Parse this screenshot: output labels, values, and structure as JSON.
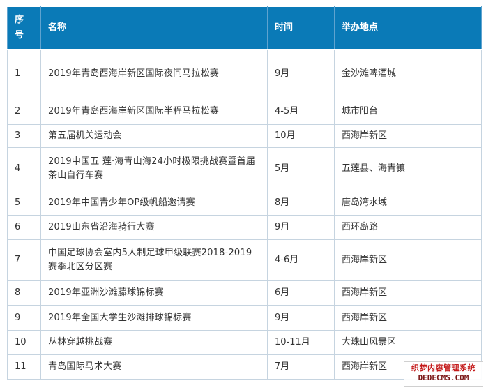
{
  "header": {
    "index_label": "序号",
    "name_label": "名称",
    "time_label": "时间",
    "venue_label": "举办地点"
  },
  "rows": [
    {
      "index": "1",
      "name": "2019年青岛西海岸新区国际夜间马拉松赛",
      "time": "9月",
      "venue": "金沙滩啤酒城"
    },
    {
      "index": "2",
      "name": "2019年青岛西海岸新区国际半程马拉松赛",
      "time": "4-5月",
      "venue": "城市阳台"
    },
    {
      "index": "3",
      "name": "第五届机关运动会",
      "time": "10月",
      "venue": "西海岸新区"
    },
    {
      "index": "4",
      "name": "2019中国五 莲·海青山海24小时极限挑战赛暨首届茶山自行车赛",
      "time": "5月",
      "venue": "五莲县、海青镇"
    },
    {
      "index": "5",
      "name": "2019年中国青少年OP级帆船邀请赛",
      "time": "8月",
      "venue": "唐岛湾水域"
    },
    {
      "index": "6",
      "name": "2019山东省沿海骑行大赛",
      "time": "9月",
      "venue": "西环岛路"
    },
    {
      "index": "7",
      "name": "中国足球协会室内5人制足球甲级联赛2018-2019 赛季北区分区赛",
      "time": "4-6月",
      "venue": "西海岸新区"
    },
    {
      "index": "8",
      "name": "2019年亚洲沙滩藤球锦标赛",
      "time": "6月",
      "venue": "西海岸新区"
    },
    {
      "index": "9",
      "name": "2019年全国大学生沙滩排球锦标赛",
      "time": "9月",
      "venue": "西海岸新区"
    },
    {
      "index": "10",
      "name": "丛林穿越挑战赛",
      "time": "10-11月",
      "venue": "大珠山风景区"
    },
    {
      "index": "11",
      "name": "青岛国际马术大赛",
      "time": "7月",
      "venue": "西海岸新区"
    }
  ],
  "watermark": {
    "line1": "织梦内容管理系统",
    "line2": "DEDECMS.COM"
  },
  "colors": {
    "header_bg": "#0a7ab7",
    "border": "#c6d4e0"
  }
}
